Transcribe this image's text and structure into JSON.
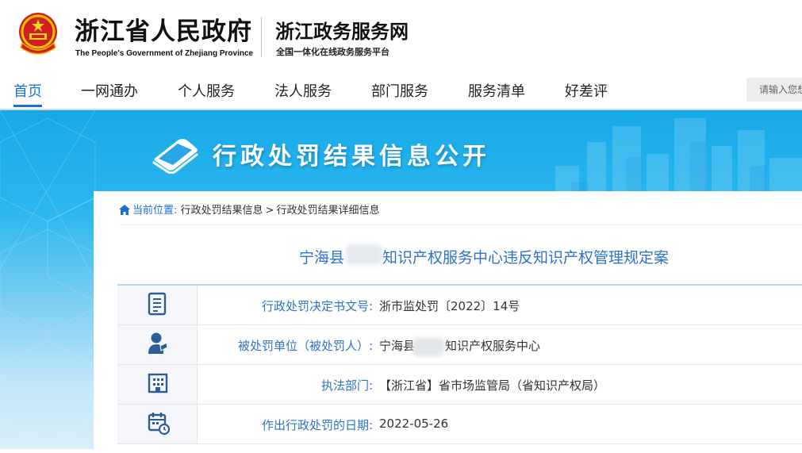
{
  "header": {
    "gov_name_cn": "浙江省人民政府",
    "gov_name_en": "The People's Government of Zhejiang Province",
    "site_name": "浙江政务服务网",
    "site_subtitle": "全国一体化在线政务服务平台"
  },
  "nav": {
    "items": [
      {
        "label": "首页",
        "active": true
      },
      {
        "label": "一网通办",
        "active": false
      },
      {
        "label": "个人服务",
        "active": false
      },
      {
        "label": "法人服务",
        "active": false
      },
      {
        "label": "部门服务",
        "active": false
      },
      {
        "label": "服务清单",
        "active": false
      },
      {
        "label": "好差评",
        "active": false
      }
    ],
    "search_placeholder": "请输入您想"
  },
  "banner": {
    "title": "行政处罚结果信息公开"
  },
  "breadcrumb": {
    "prefix": "当前位置:",
    "items": [
      "行政处罚结果信息",
      "行政处罚结果详细信息"
    ],
    "separator": ">"
  },
  "case": {
    "title_part1": "宁海县",
    "title_part2": "知识产权服务中心违反知识产权管理规定案"
  },
  "details": [
    {
      "icon": "document-icon",
      "label": "行政处罚决定书文号:",
      "value": "浙市监处罚〔2022〕14号"
    },
    {
      "icon": "person-icon",
      "label": "被处罚单位（被处罚人）:",
      "value_part1": "宁海县",
      "value_part2": "知识产权服务中心"
    },
    {
      "icon": "building-icon",
      "label": "执法部门:",
      "value": "【浙江省】省市场监管局（省知识产权局）"
    },
    {
      "icon": "calendar-icon",
      "label": "作出行政处罚的日期:",
      "value": "2022-05-26"
    }
  ],
  "colors": {
    "accent": "#1c6fd3",
    "label_blue": "#2c73c8",
    "banner_top": "#16a9e8"
  }
}
